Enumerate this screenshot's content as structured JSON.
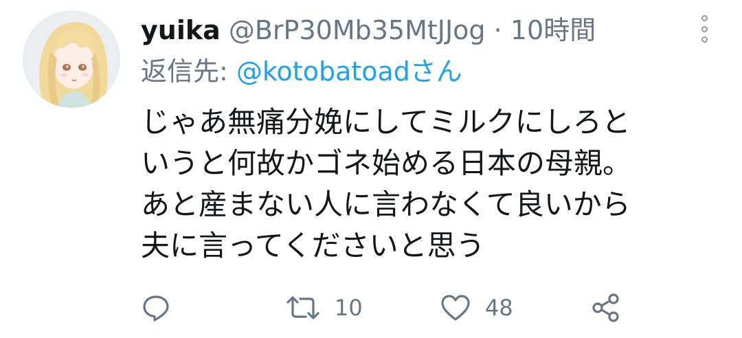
{
  "tweet": {
    "display_name": "yuika",
    "handle": "@BrP30Mb35MtJJog",
    "separator": "·",
    "time": "10時間",
    "reply_prefix": "返信先:",
    "reply_to": "@kotobatoadさん",
    "lines": [
      "じゃあ無痛分娩にしてミルクにしろと",
      "いうと何故かゴネ始める日本の母親。",
      "あと産まない人に言わなくて良いから",
      "夫に言ってくださいと思う"
    ]
  },
  "actions": {
    "reply_icon": "comment-icon",
    "retweet_icon": "retweet-icon",
    "retweet_count": "10",
    "like_icon": "heart-icon",
    "like_count": "48",
    "share_icon": "share-icon"
  },
  "colors": {
    "name": "#14171a",
    "secondary": "#657786",
    "mention": "#1da1f2",
    "body": "#14171a"
  }
}
